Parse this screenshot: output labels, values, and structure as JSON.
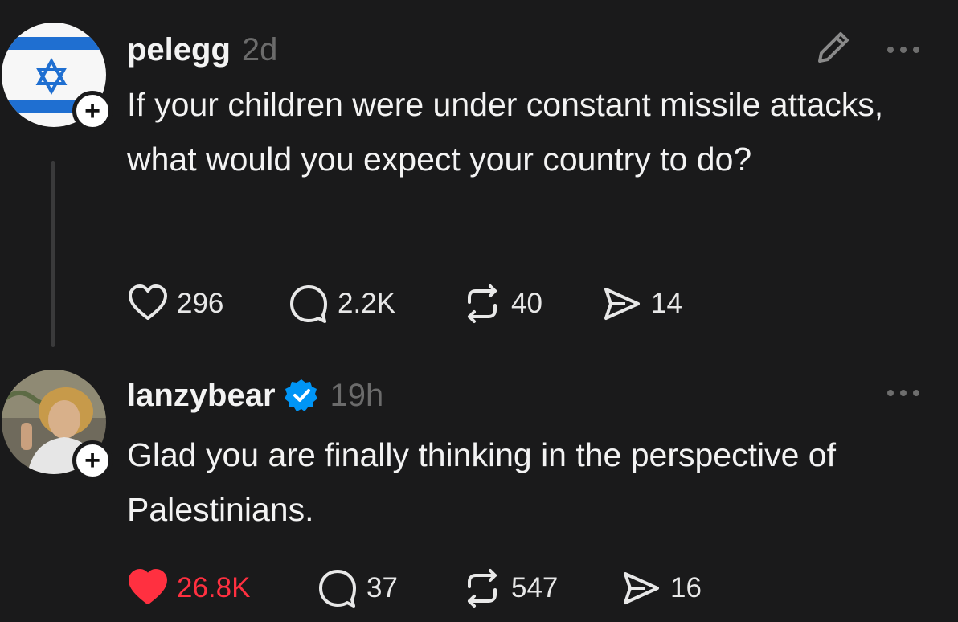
{
  "posts": [
    {
      "username": "pelegg",
      "time": "2d",
      "verified": false,
      "avatar_icon": "israel-flag-avatar",
      "text": "If your children were under constant missile attacks, what would you expect your country to do?",
      "actions": {
        "likes": "296",
        "replies": "2.2K",
        "reposts": "40",
        "shares": "14",
        "liked": false
      }
    },
    {
      "username": "lanzybear",
      "time": "19h",
      "verified": true,
      "avatar_icon": "user-photo-avatar",
      "text": "Glad you are finally thinking in the perspective of Palestinians.",
      "actions": {
        "likes": "26.8K",
        "replies": "37",
        "reposts": "547",
        "shares": "16",
        "liked": true
      }
    }
  ],
  "colors": {
    "background": "#1a1a1b",
    "text": "#f3f3f3",
    "muted": "#6b6b6b",
    "like_active": "#ff3040",
    "verified": "#0095f6",
    "flag_blue": "#1f6fd1"
  },
  "icons": [
    "heart-icon",
    "comment-icon",
    "repost-icon",
    "share-icon",
    "edit-icon",
    "more-icon",
    "verified-badge-icon",
    "follow-plus-icon"
  ]
}
